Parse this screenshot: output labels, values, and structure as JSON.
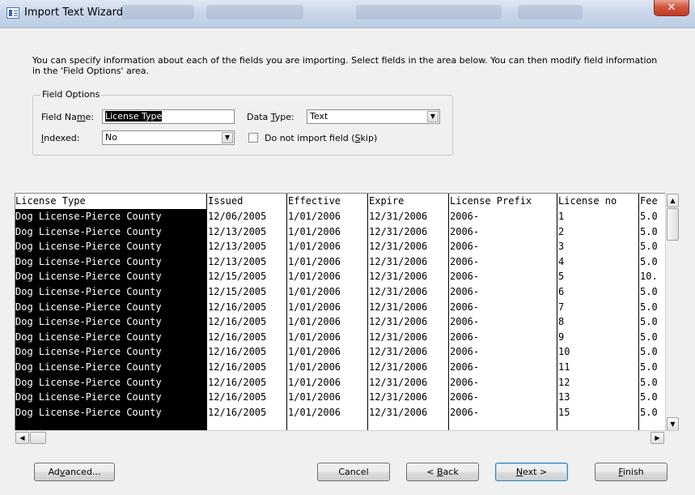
{
  "window": {
    "title": "Import Text Wizard",
    "close_glyph": "✕",
    "app_icon": "access-wizard-icon"
  },
  "description": "You can specify information about each of the fields you are importing.  Select fields in the area below. You can then modify field information in the 'Field Options' area.",
  "field_options": {
    "legend": "Field Options",
    "field_name_label": "Field Name:",
    "field_name_value": "License Type",
    "data_type_label": "Data Type:",
    "data_type_value": "Text",
    "indexed_label": "Indexed:",
    "indexed_value": "No",
    "skip_label": "Do not import field (Skip)",
    "skip_checked": false
  },
  "grid": {
    "headers": [
      "License Type",
      "Issued",
      "Effective",
      "Expire",
      "License Prefix",
      "License no",
      "Fee"
    ],
    "rows": [
      [
        "Dog License-Pierce County",
        "12/06/2005",
        "1/01/2006",
        "12/31/2006",
        "2006-",
        "1",
        "5.0"
      ],
      [
        "Dog License-Pierce County",
        "12/13/2005",
        "1/01/2006",
        "12/31/2006",
        "2006-",
        "2",
        "5.0"
      ],
      [
        "Dog License-Pierce County",
        "12/13/2005",
        "1/01/2006",
        "12/31/2006",
        "2006-",
        "3",
        "5.0"
      ],
      [
        "Dog License-Pierce County",
        "12/13/2005",
        "1/01/2006",
        "12/31/2006",
        "2006-",
        "4",
        "5.0"
      ],
      [
        "Dog License-Pierce County",
        "12/15/2005",
        "1/01/2006",
        "12/31/2006",
        "2006-",
        "5",
        "10."
      ],
      [
        "Dog License-Pierce County",
        "12/15/2005",
        "1/01/2006",
        "12/31/2006",
        "2006-",
        "6",
        "5.0"
      ],
      [
        "Dog License-Pierce County",
        "12/16/2005",
        "1/01/2006",
        "12/31/2006",
        "2006-",
        "7",
        "5.0"
      ],
      [
        "Dog License-Pierce County",
        "12/16/2005",
        "1/01/2006",
        "12/31/2006",
        "2006-",
        "8",
        "5.0"
      ],
      [
        "Dog License-Pierce County",
        "12/16/2005",
        "1/01/2006",
        "12/31/2006",
        "2006-",
        "9",
        "5.0"
      ],
      [
        "Dog License-Pierce County",
        "12/16/2005",
        "1/01/2006",
        "12/31/2006",
        "2006-",
        "10",
        "5.0"
      ],
      [
        "Dog License-Pierce County",
        "12/16/2005",
        "1/01/2006",
        "12/31/2006",
        "2006-",
        "11",
        "5.0"
      ],
      [
        "Dog License-Pierce County",
        "12/16/2005",
        "1/01/2006",
        "12/31/2006",
        "2006-",
        "12",
        "5.0"
      ],
      [
        "Dog License-Pierce County",
        "12/16/2005",
        "1/01/2006",
        "12/31/2006",
        "2006-",
        "13",
        "5.0"
      ],
      [
        "Dog License-Pierce County",
        "12/16/2005",
        "1/01/2006",
        "12/31/2006",
        "2006-",
        "15",
        "5.0"
      ]
    ]
  },
  "buttons": {
    "advanced": "Advanced...",
    "cancel": "Cancel",
    "back": "< Back",
    "next": "Next >",
    "finish": "Finish"
  },
  "icons": {
    "scroll_up": "▲",
    "scroll_down": "▼",
    "scroll_left": "◀",
    "scroll_right": "▶",
    "dropdown": "▼"
  }
}
